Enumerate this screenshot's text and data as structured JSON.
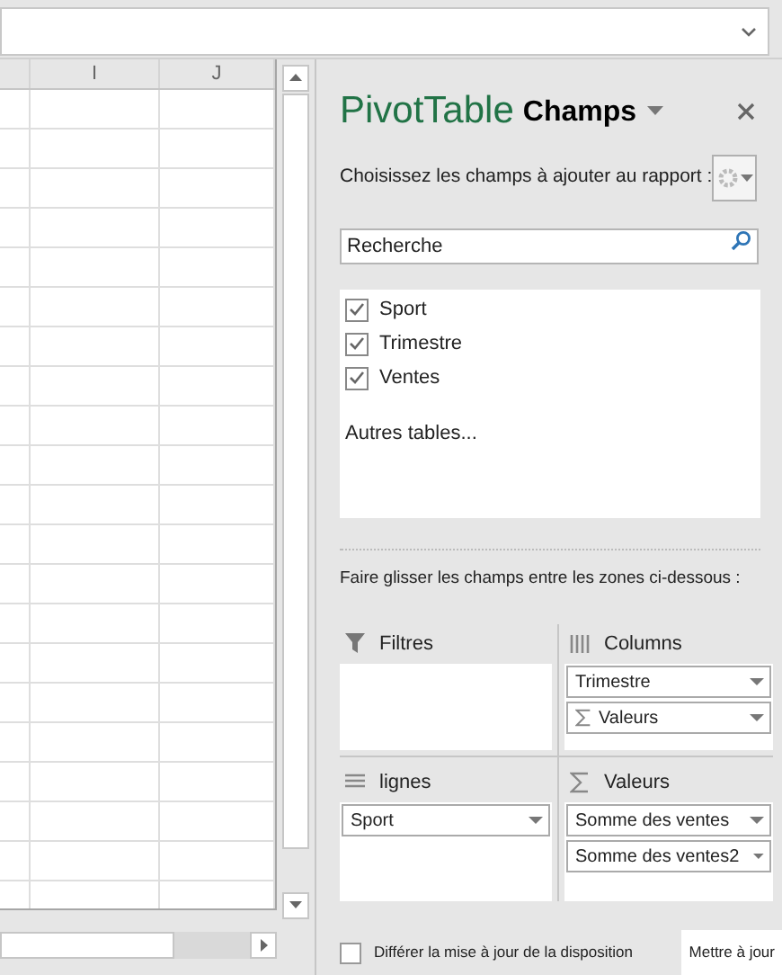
{
  "sheet": {
    "columns": [
      {
        "label": "I"
      },
      {
        "label": "J"
      }
    ]
  },
  "panel": {
    "title": "PivotTable",
    "subtitle": "Champs",
    "prompt": "Choisissez les champs à ajouter au rapport :",
    "search": {
      "placeholder": "Recherche"
    },
    "fields": [
      {
        "label": "Sport",
        "checked": true
      },
      {
        "label": "Trimestre",
        "checked": true
      },
      {
        "label": "Ventes",
        "checked": true
      }
    ],
    "more_tables": "Autres tables...",
    "drag_hint": "Faire glisser les champs entre les zones ci-dessous :",
    "areas": [
      {
        "kind": "filters",
        "title": "Filtres"
      },
      {
        "kind": "columns",
        "title": "Columns",
        "items": [
          {
            "label": "Trimestre"
          },
          {
            "label": "Valeurs",
            "kind": "sigma"
          }
        ]
      },
      {
        "kind": "rows",
        "title": "lignes",
        "items": [
          {
            "label": "Sport"
          }
        ]
      },
      {
        "kind": "values",
        "title": "Valeurs",
        "items": [
          {
            "label": "Somme des ventes"
          },
          {
            "label": "Somme des ventes2"
          }
        ]
      }
    ],
    "defer": {
      "label": "Différer la mise à jour de la disposition",
      "checked": false
    },
    "update_button": "Mettre à jour"
  }
}
